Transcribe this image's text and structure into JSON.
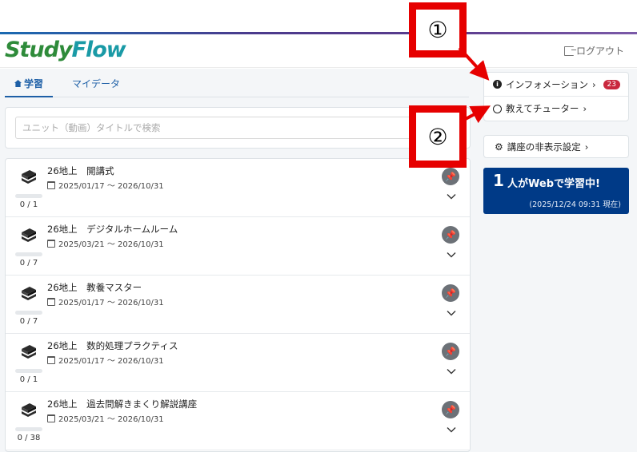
{
  "header": {
    "logo_study": "Study",
    "logo_flow": "Flow",
    "logout_label": "ログアウト"
  },
  "tabs": [
    {
      "label": "学習",
      "active": true
    },
    {
      "label": "マイデータ",
      "active": false
    }
  ],
  "search": {
    "placeholder": "ユニット（動画）タイトルで検索"
  },
  "courses": [
    {
      "title": "26地上　開講式",
      "date": "2025/01/17 ～ 2026/10/31",
      "progress": "0 / 1"
    },
    {
      "title": "26地上　デジタルホームルーム",
      "date": "2025/03/21 ～ 2026/10/31",
      "progress": "0 / 7"
    },
    {
      "title": "26地上　教養マスター",
      "date": "2025/01/17 ～ 2026/10/31",
      "progress": "0 / 7"
    },
    {
      "title": "26地上　数的処理プラクティス",
      "date": "2025/01/17 ～ 2026/10/31",
      "progress": "0 / 1"
    },
    {
      "title": "26地上　過去問解きまくり解説講座",
      "date": "2025/03/21 ～ 2026/10/31",
      "progress": "0 / 38"
    }
  ],
  "sidebar": {
    "information_label": "インフォメーション",
    "information_badge": "23",
    "tutor_label": "教えてチューター",
    "hide_settings_label": "講座の非表示設定",
    "live_count": "1",
    "live_text": "人がWebで学習中!",
    "live_time": "(2025/12/24 09:31 現在)"
  },
  "callouts": {
    "one": "①",
    "two": "②"
  },
  "colors": {
    "brand_blue": "#1d5fa6",
    "live_bg": "#003a87",
    "badge_red": "#c9283e",
    "callout_red": "#e60000"
  }
}
